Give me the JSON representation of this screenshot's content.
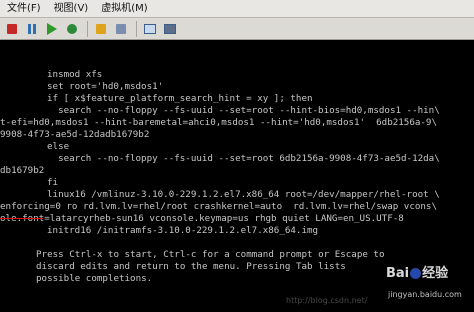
{
  "menu": [
    "文件(F)",
    "视图(V)",
    "虚拟机(M)"
  ],
  "toolbar": {
    "icons": [
      "stop-icon",
      "pause-icon",
      "play-icon",
      "reset-icon",
      "power-icon",
      "snapshot-icon",
      "window-icon",
      "fullscreen-icon"
    ]
  },
  "console": {
    "lines": [
      "insmod xfs",
      "set root='hd0,msdos1'",
      "if [ x$feature_platform_search_hint = xy ]; then",
      "  search --no-floppy --fs-uuid --set=root --hint-bios=hd0,msdos1 --hin\\",
      "t-efi=hd0,msdos1 --hint-baremetal=ahci0,msdos1 --hint='hd0,msdos1'  6db2156a-9\\",
      "9908-4f73-ae5d-12dadb1679b2",
      "else",
      "  search --no-floppy --fs-uuid --set=root 6db2156a-9908-4f73-ae5d-12da\\",
      "db1679b2",
      "fi",
      "linux16 /vmlinuz-3.10.0-229.1.2.el7.x86_64 root=/dev/mapper/rhel-root \\",
      "enforcing=0 ro rd.lvm.lv=rhel/root crashkernel=auto  rd.lvm.lv=rhel/swap vcons\\",
      "ole.font=latarcyrheb-sun16 vconsole.keymap=us rhgb quiet LANG=en_US.UTF-8",
      "initrd16 /initramfs-3.10.0-229.1.2.el7.x86_64.img",
      "Press Ctrl-x to start, Ctrl-c for a command prompt or Escape to",
      "discard edits and return to the menu. Pressing Tab lists",
      "possible completions."
    ]
  },
  "watermark": {
    "logo_left": "Bai",
    "logo_right": "经验",
    "sub": "jingyan.baidu.com",
    "blog": "http://blog.csdn.net/"
  }
}
